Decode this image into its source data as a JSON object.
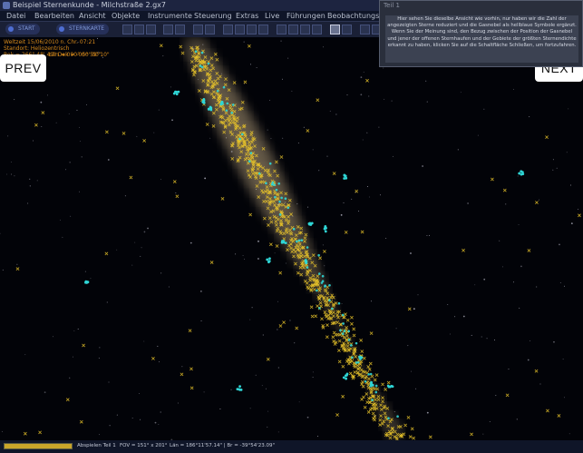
{
  "window": {
    "title": "Beispiel Sternenkunde - Milchstraße 2.gx7"
  },
  "menu": [
    "Datei",
    "Bearbeiten",
    "Ansicht",
    "Objekte",
    "Instrumente",
    "Steuerung",
    "Extras",
    "Live",
    "Führungen",
    "Beobachtungsplan"
  ],
  "toolbar": {
    "tab_start": "START",
    "tab_second": "STERNKARTE"
  },
  "info": {
    "line1": "Weltzeit 15/06/2010 n. Chr. 07:21",
    "line2": "Standort: Heliozentrisch",
    "line3": "Rek = 266° 48' 49\" Dek = -05° 59' 10\"",
    "line4": "Län = 090° 00' 00\""
  },
  "nav": {
    "prev": "PREV",
    "next": "NEXT"
  },
  "tooltip": {
    "header": "Teil 1",
    "body": "Hier sehen Sie dieselbe Ansicht wie vorhin, nur haben wir die Zahl der angezeigten Sterne reduziert und die Gasnebel als hellblaue Symbole ergänzt. Wenn Sie der Meinung sind, den Bezug zwischen der Position der Gasnebel und jener der offenen Sternhaufen und der Gebiete der größten Sternendichte erkannt zu haben, klicken Sie auf die Schaltfläche Schließen, um fortzufahren."
  },
  "status": {
    "progress": 1.0,
    "play_label": "Abspielen Teil 1",
    "fov": "FOV = 151° x 201°",
    "position": "Län = 186°11'57.14\" | Br = -39°54'23.09\""
  },
  "colors": {
    "cluster": "#e6c22a",
    "nebula": "#2fd6d6",
    "tooltip_bg": "#3c4252"
  }
}
